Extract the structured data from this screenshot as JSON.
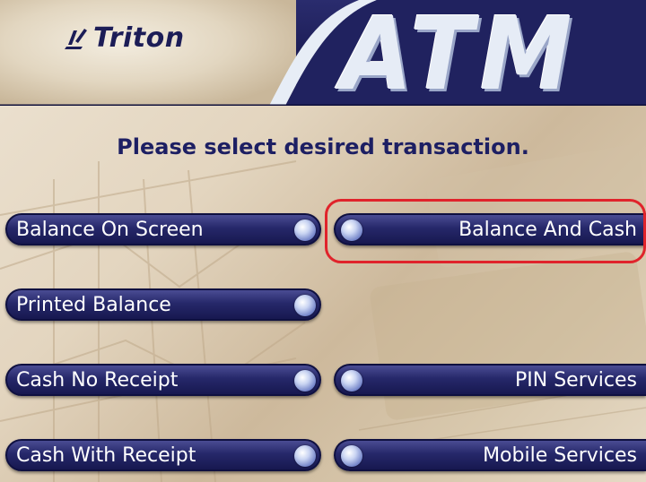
{
  "header": {
    "brand": "Triton",
    "title": "ATM"
  },
  "prompt": "Please select desired transaction.",
  "left_buttons": [
    {
      "label": "Balance On Screen"
    },
    {
      "label": "Printed Balance"
    },
    {
      "label": "Cash No Receipt"
    },
    {
      "label": "Cash With Receipt"
    }
  ],
  "right_buttons": [
    {
      "label": "Balance And Cash",
      "highlighted": true
    },
    {
      "label": "PIN Services"
    },
    {
      "label": "Mobile Services"
    }
  ],
  "colors": {
    "header_bg": "#1a1b52",
    "button_bg": "#26286a",
    "prompt_text": "#1d1f63",
    "highlight": "#e0232b"
  }
}
